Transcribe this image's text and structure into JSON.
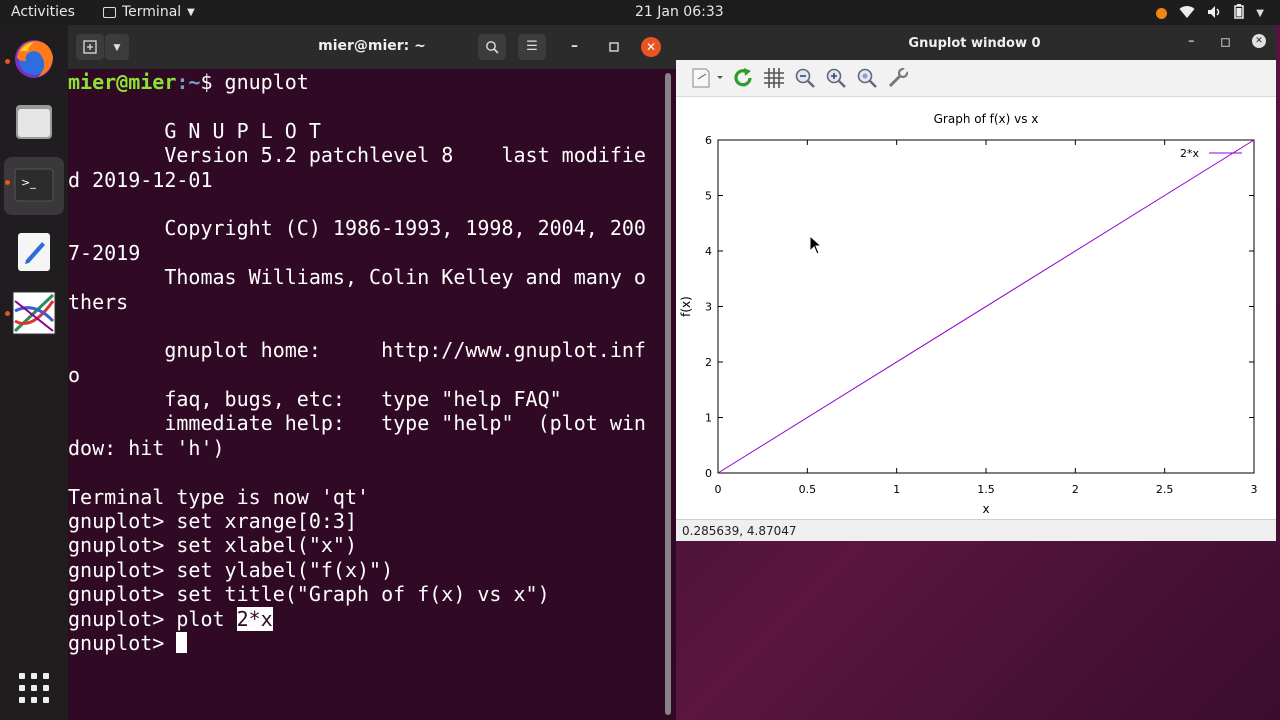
{
  "topbar": {
    "activities": "Activities",
    "app_menu": "Terminal",
    "clock": "21 Jan  06:33"
  },
  "dock": {
    "items": [
      {
        "icon": "firefox-icon"
      },
      {
        "icon": "files-icon"
      },
      {
        "icon": "terminal-icon"
      },
      {
        "icon": "text-editor-icon"
      },
      {
        "icon": "gnuplot-icon"
      },
      {
        "icon": "show-applications-icon"
      }
    ]
  },
  "terminal": {
    "title": "mier@mier: ~",
    "prompt_user": "mier@mier",
    "prompt_path": ":~",
    "first_command": "$ gnuplot",
    "lines": [
      "",
      "        G N U P L O T",
      "        Version 5.2 patchlevel 8    last modifie",
      "d 2019-12-01",
      "",
      "        Copyright (C) 1986-1993, 1998, 2004, 200",
      "7-2019",
      "        Thomas Williams, Colin Kelley and many o",
      "thers",
      "",
      "        gnuplot home:     http://www.gnuplot.inf",
      "o",
      "        faq, bugs, etc:   type \"help FAQ\"",
      "        immediate help:   type \"help\"  (plot win",
      "dow: hit 'h')",
      "",
      "Terminal type is now 'qt'",
      "gnuplot> set xrange[0:3]",
      "gnuplot> set xlabel(\"x\")",
      "gnuplot> set ylabel(\"f(x)\")",
      "gnuplot> set title(\"Graph of f(x) vs x\")"
    ],
    "plot_prefix": "gnuplot> plot ",
    "plot_selected": "2*x",
    "final_prompt": "gnuplot> "
  },
  "gnuplot": {
    "window_title": "Gnuplot window 0",
    "status": "0.285639, 4.87047",
    "toolbar_icons": [
      "export-icon",
      "replot-icon",
      "grid-icon",
      "zoom-previous-icon",
      "zoom-in-icon",
      "zoom-out-icon",
      "settings-icon"
    ]
  },
  "chart_data": {
    "type": "line",
    "title": "Graph of f(x) vs x",
    "xlabel": "x",
    "ylabel": "f(x)",
    "xlim": [
      0,
      3
    ],
    "ylim": [
      0,
      6
    ],
    "xticks": [
      "0",
      "0.5",
      "1",
      "1.5",
      "2",
      "2.5",
      "3"
    ],
    "yticks": [
      "0",
      "1",
      "2",
      "3",
      "4",
      "5",
      "6"
    ],
    "grid": false,
    "legend_position": "top-right",
    "series": [
      {
        "name": "2*x",
        "color": "#9400d3",
        "x": [
          0,
          3
        ],
        "y": [
          0,
          6
        ]
      }
    ]
  }
}
